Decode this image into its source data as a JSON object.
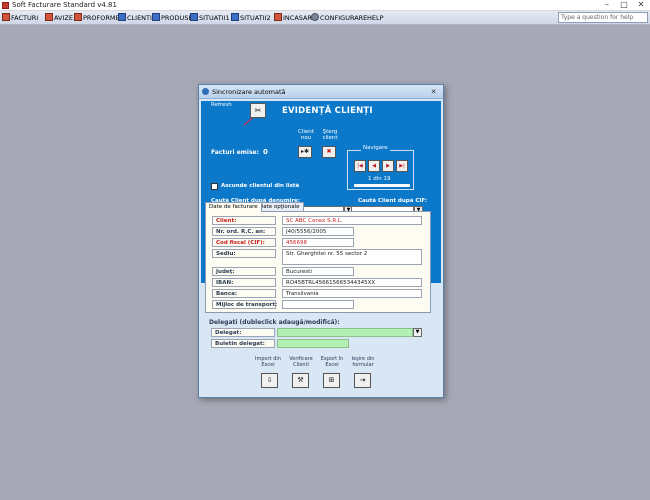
{
  "app": {
    "title": "Soft Facturare Standard v4.81",
    "window_controls": [
      "–",
      "□",
      "✕"
    ],
    "help_placeholder": "Type a question for help"
  },
  "menu": {
    "items": [
      {
        "label": "FACTURI",
        "icon": "document-red-icon"
      },
      {
        "label": "AVIZE",
        "icon": "document-red-icon"
      },
      {
        "label": "PROFORME",
        "icon": "document-red-icon"
      },
      {
        "label": "CLIENTI",
        "icon": "clients-icon"
      },
      {
        "label": "PRODUSE",
        "icon": "products-icon"
      },
      {
        "label": "SITUATII1",
        "icon": "report-icon"
      },
      {
        "label": "SITUATII2",
        "icon": "report-icon"
      },
      {
        "label": "INCASARI",
        "icon": "cash-icon"
      },
      {
        "label": "CONFIGURARE",
        "icon": "gear-icon"
      },
      {
        "label": "HELP",
        "icon": ""
      }
    ]
  },
  "dialog": {
    "title": "Sincronizare automată",
    "close": "✕",
    "refresh_label": "Refresh",
    "form_title": "EVIDENȚĂ CLIENȚI",
    "facturi_label": "Facturi emise:",
    "facturi_value": "0",
    "client_nou_label": "Client nou",
    "sterg_client_label": "Şterg client",
    "navigare_label": "Navigare",
    "nav_counter": "1  din  19",
    "ascunde_label": "Ascunde clientul din listă",
    "cauta_denumire_label": "Caută Client după denumire:",
    "cauta_cif_label": "Caută Client după CIF:"
  },
  "tabs": [
    {
      "label": "Date de facturare",
      "active": true
    },
    {
      "label": "Date opţionale",
      "active": false
    }
  ],
  "fields": {
    "client": {
      "label": "Client:",
      "value": "SC ABC Conex S.R.L."
    },
    "nr_ord": {
      "label": "Nr. ord. R.C. an:",
      "value": "J40/5556/2005"
    },
    "cod_fiscal": {
      "label": "Cod fiscal (CIF):",
      "value": "456698"
    },
    "sediu": {
      "label": "Sediu:",
      "value": "Str. Gherghitei nr. 55 sector 2"
    },
    "judet": {
      "label": "Judeţ:",
      "value": "Bucuresti"
    },
    "iban": {
      "label": "IBAN:",
      "value": "RO45BTRL456615665344345XX"
    },
    "banca": {
      "label": "Banca:",
      "value": "Transilvania"
    },
    "mijloc_transport": {
      "label": "Mijloc de transport:",
      "value": ""
    }
  },
  "delegati": {
    "title": "Delegati (dubleclick adaugă/modifică):",
    "delegat_label": "Delegat:",
    "buletin_label": "Buletin delegat:"
  },
  "actions": [
    {
      "label": "Import din Excel",
      "icon": "import-excel-icon",
      "glyph": "⇩"
    },
    {
      "label": "Verificare Clienti",
      "icon": "tools-icon",
      "glyph": "⚒"
    },
    {
      "label": "Export în Excel",
      "icon": "export-excel-icon",
      "glyph": "⊞"
    },
    {
      "label": "Ieşire din formular",
      "icon": "exit-icon",
      "glyph": "⇥"
    }
  ],
  "colors": {
    "desktop": "#a6a8b6",
    "form_header": "#0b78c9",
    "required_label": "#c81e1e",
    "delegat_field": "#b3f0b3"
  }
}
